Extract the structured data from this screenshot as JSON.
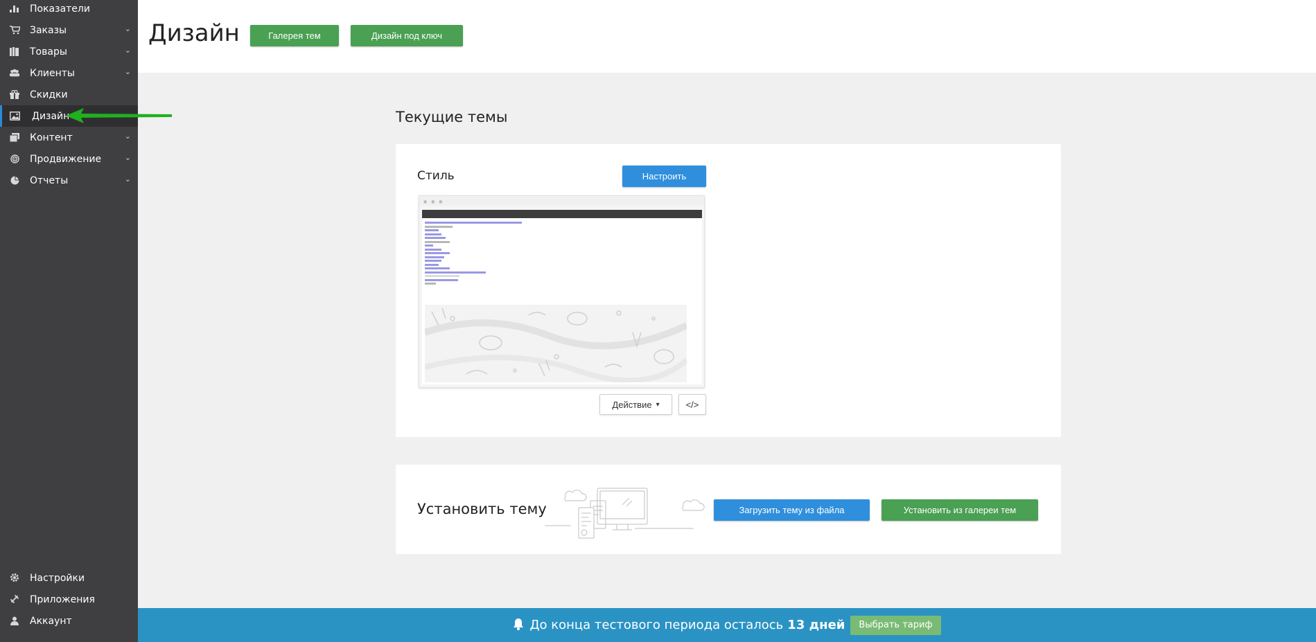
{
  "sidebar": {
    "items": [
      {
        "label": "Показатели",
        "icon": "bar-chart-icon",
        "has_submenu": false
      },
      {
        "label": "Заказы",
        "icon": "cart-icon",
        "has_submenu": true
      },
      {
        "label": "Товары",
        "icon": "books-icon",
        "has_submenu": true
      },
      {
        "label": "Клиенты",
        "icon": "users-icon",
        "has_submenu": true
      },
      {
        "label": "Скидки",
        "icon": "gift-icon",
        "has_submenu": false
      },
      {
        "label": "Дизайн",
        "icon": "image-icon",
        "has_submenu": false,
        "active": true
      },
      {
        "label": "Контент",
        "icon": "pages-icon",
        "has_submenu": true
      },
      {
        "label": "Продвижение",
        "icon": "target-icon",
        "has_submenu": true
      },
      {
        "label": "Отчеты",
        "icon": "pie-chart-icon",
        "has_submenu": true
      }
    ],
    "bottom_items": [
      {
        "label": "Настройки",
        "icon": "gear-icon"
      },
      {
        "label": "Приложения",
        "icon": "puzzle-icon"
      },
      {
        "label": "Аккаунт",
        "icon": "user-icon"
      }
    ]
  },
  "header": {
    "title": "Дизайн",
    "gallery_button": "Галерея тем",
    "turnkey_button": "Дизайн под ключ"
  },
  "current_themes": {
    "title": "Текущие темы",
    "theme_name": "Стиль",
    "configure_button": "Настроить",
    "action_button": "Действие",
    "code_button": "</>"
  },
  "install": {
    "title": "Установить тему",
    "upload_button": "Загрузить тему из файла",
    "gallery_button": "Установить из галереи тем"
  },
  "trial": {
    "text": "До конца тестового периода осталось",
    "days": "13 дней",
    "button": "Выбрать тариф"
  },
  "colors": {
    "sidebar_bg": "#3f3f42",
    "accent_green": "#4aa053",
    "accent_blue": "#2f8fdc",
    "trial_bar": "#2a93c4",
    "annotation_arrow": "#1fb11f"
  }
}
